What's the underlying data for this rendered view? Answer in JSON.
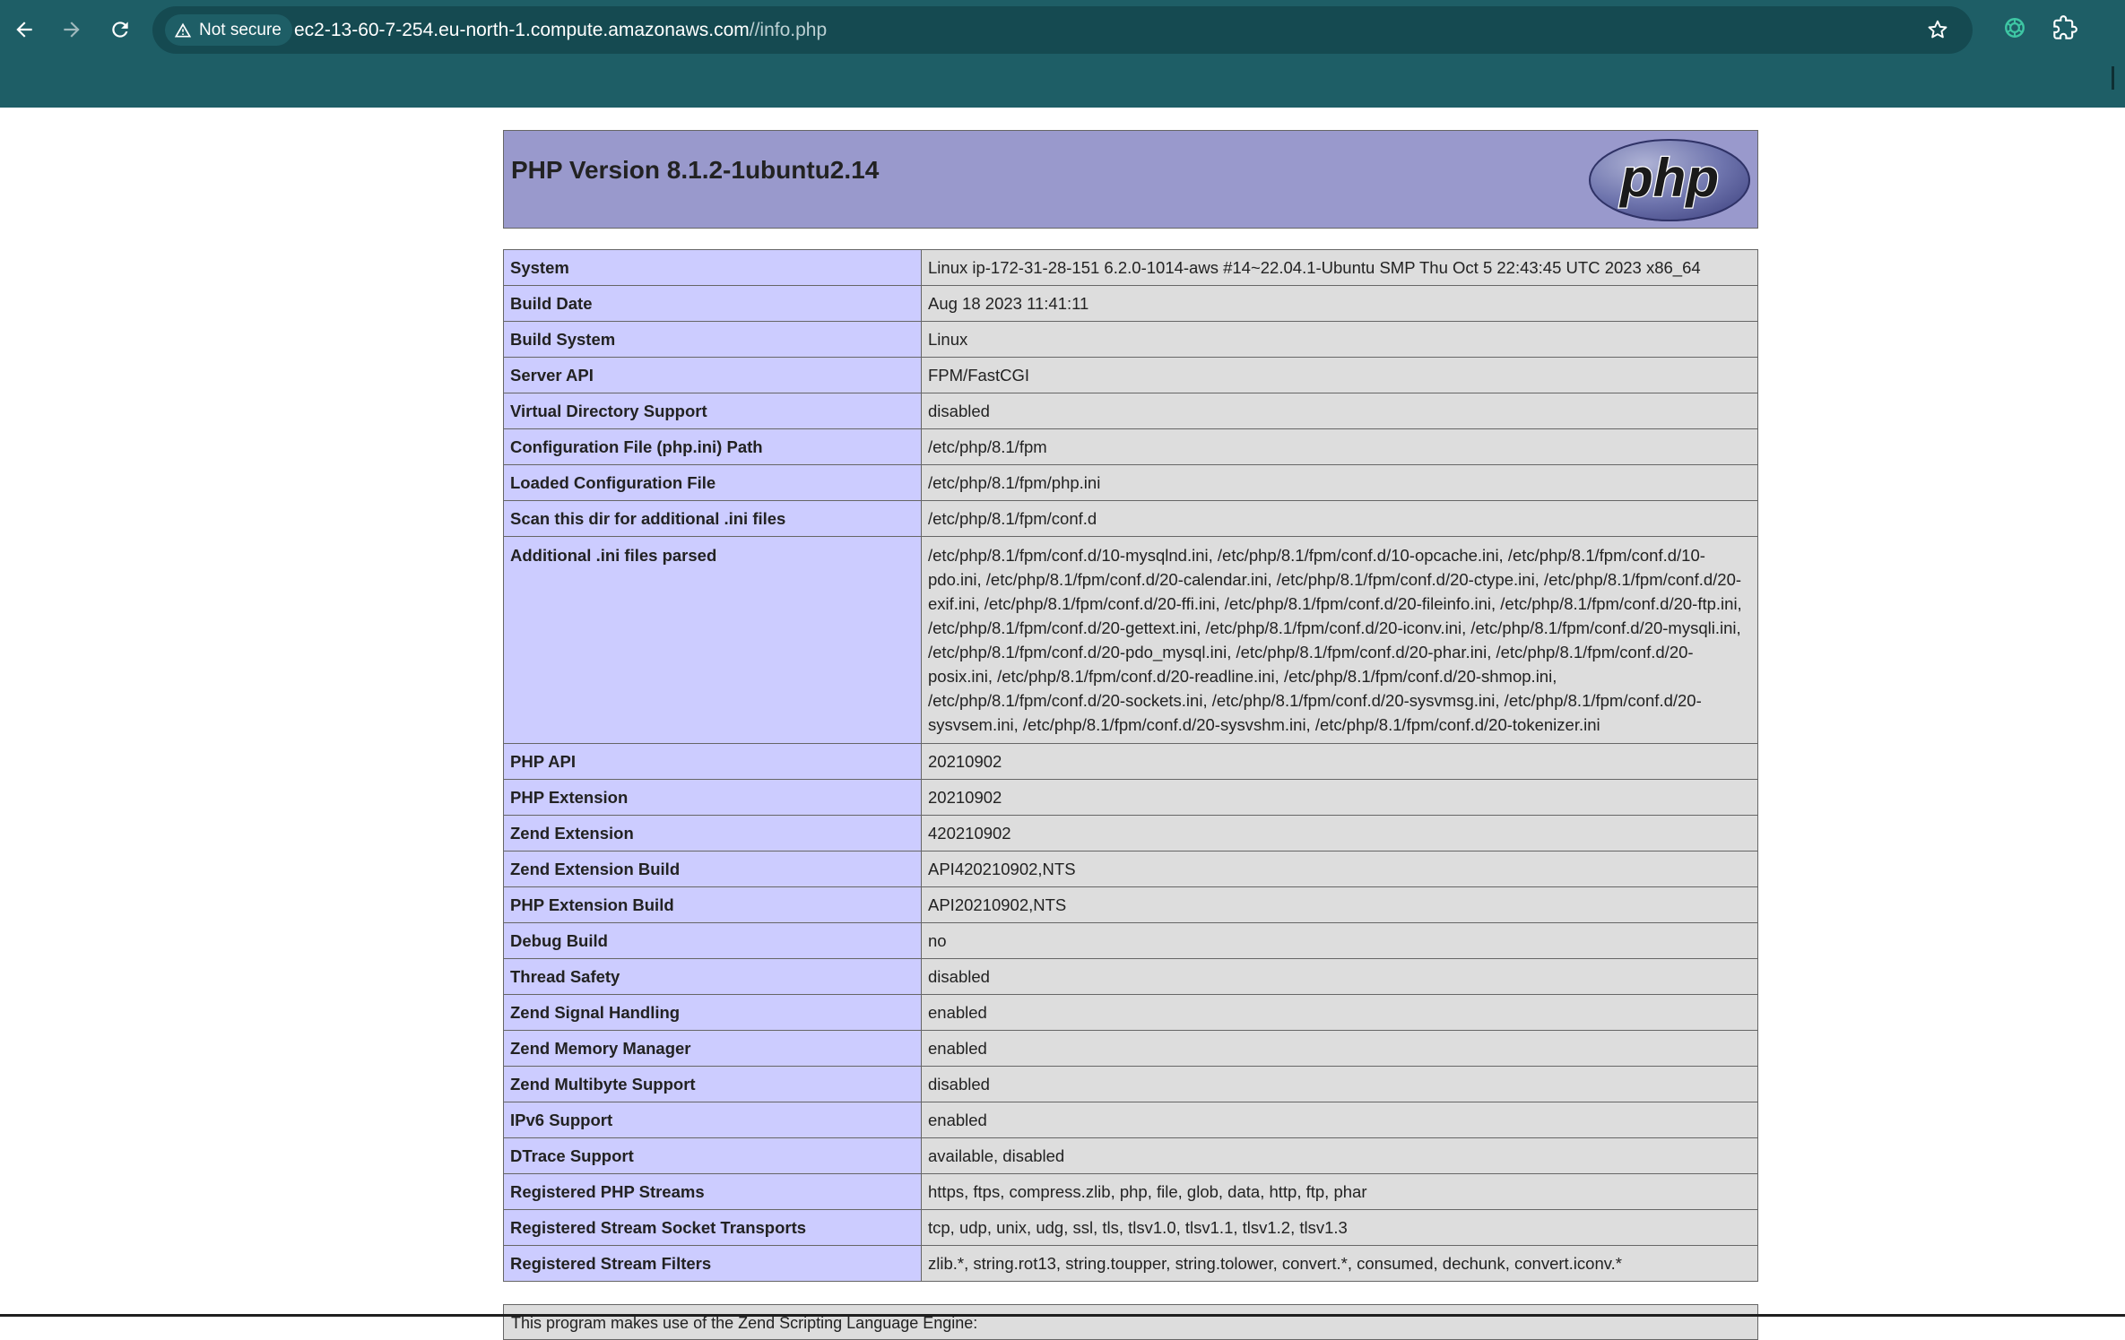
{
  "browser": {
    "security_label": "Not secure",
    "url_host": "ec2-13-60-7-254.eu-north-1.compute.amazonaws.com",
    "url_path": "//info.php",
    "icons": {
      "back": "arrow-left-icon",
      "forward": "arrow-right-icon",
      "reload": "reload-icon",
      "warning": "warning-triangle-icon",
      "bookmark": "star-icon",
      "extension_openai": "openai-icon",
      "extensions": "puzzle-piece-icon"
    }
  },
  "header": {
    "title": "PHP Version 8.1.2-1ubuntu2.14",
    "logo_text": "php"
  },
  "colors": {
    "header_bg": "#9999cc",
    "label_cell_bg": "#ccccff",
    "value_cell_bg": "#dddddd",
    "chrome_bg": "#1e5e66"
  },
  "rows": [
    {
      "label": "System",
      "value": "Linux ip-172-31-28-151 6.2.0-1014-aws #14~22.04.1-Ubuntu SMP Thu Oct 5 22:43:45 UTC 2023 x86_64"
    },
    {
      "label": "Build Date",
      "value": "Aug 18 2023 11:41:11"
    },
    {
      "label": "Build System",
      "value": "Linux"
    },
    {
      "label": "Server API",
      "value": "FPM/FastCGI"
    },
    {
      "label": "Virtual Directory Support",
      "value": "disabled"
    },
    {
      "label": "Configuration File (php.ini) Path",
      "value": "/etc/php/8.1/fpm"
    },
    {
      "label": "Loaded Configuration File",
      "value": "/etc/php/8.1/fpm/php.ini"
    },
    {
      "label": "Scan this dir for additional .ini files",
      "value": "/etc/php/8.1/fpm/conf.d"
    },
    {
      "label": "Additional .ini files parsed",
      "value": "/etc/php/8.1/fpm/conf.d/10-mysqlnd.ini, /etc/php/8.1/fpm/conf.d/10-opcache.ini, /etc/php/8.1/fpm/conf.d/10-pdo.ini, /etc/php/8.1/fpm/conf.d/20-calendar.ini, /etc/php/8.1/fpm/conf.d/20-ctype.ini, /etc/php/8.1/fpm/conf.d/20-exif.ini, /etc/php/8.1/fpm/conf.d/20-ffi.ini, /etc/php/8.1/fpm/conf.d/20-fileinfo.ini, /etc/php/8.1/fpm/conf.d/20-ftp.ini, /etc/php/8.1/fpm/conf.d/20-gettext.ini, /etc/php/8.1/fpm/conf.d/20-iconv.ini, /etc/php/8.1/fpm/conf.d/20-mysqli.ini, /etc/php/8.1/fpm/conf.d/20-pdo_mysql.ini, /etc/php/8.1/fpm/conf.d/20-phar.ini, /etc/php/8.1/fpm/conf.d/20-posix.ini, /etc/php/8.1/fpm/conf.d/20-readline.ini, /etc/php/8.1/fpm/conf.d/20-shmop.ini, /etc/php/8.1/fpm/conf.d/20-sockets.ini, /etc/php/8.1/fpm/conf.d/20-sysvmsg.ini, /etc/php/8.1/fpm/conf.d/20-sysvsem.ini, /etc/php/8.1/fpm/conf.d/20-sysvshm.ini, /etc/php/8.1/fpm/conf.d/20-tokenizer.ini"
    },
    {
      "label": "PHP API",
      "value": "20210902"
    },
    {
      "label": "PHP Extension",
      "value": "20210902"
    },
    {
      "label": "Zend Extension",
      "value": "420210902"
    },
    {
      "label": "Zend Extension Build",
      "value": "API420210902,NTS"
    },
    {
      "label": "PHP Extension Build",
      "value": "API20210902,NTS"
    },
    {
      "label": "Debug Build",
      "value": "no"
    },
    {
      "label": "Thread Safety",
      "value": "disabled"
    },
    {
      "label": "Zend Signal Handling",
      "value": "enabled"
    },
    {
      "label": "Zend Memory Manager",
      "value": "enabled"
    },
    {
      "label": "Zend Multibyte Support",
      "value": "disabled"
    },
    {
      "label": "IPv6 Support",
      "value": "enabled"
    },
    {
      "label": "DTrace Support",
      "value": "available, disabled"
    },
    {
      "label": "Registered PHP Streams",
      "value": "https, ftps, compress.zlib, php, file, glob, data, http, ftp, phar"
    },
    {
      "label": "Registered Stream Socket Transports",
      "value": "tcp, udp, unix, udg, ssl, tls, tlsv1.0, tlsv1.1, tlsv1.2, tlsv1.3"
    },
    {
      "label": "Registered Stream Filters",
      "value": "zlib.*, string.rot13, string.toupper, string.tolower, convert.*, consumed, dechunk, convert.iconv.*"
    }
  ],
  "footer": {
    "text": "This program makes use of the Zend Scripting Language Engine:"
  }
}
